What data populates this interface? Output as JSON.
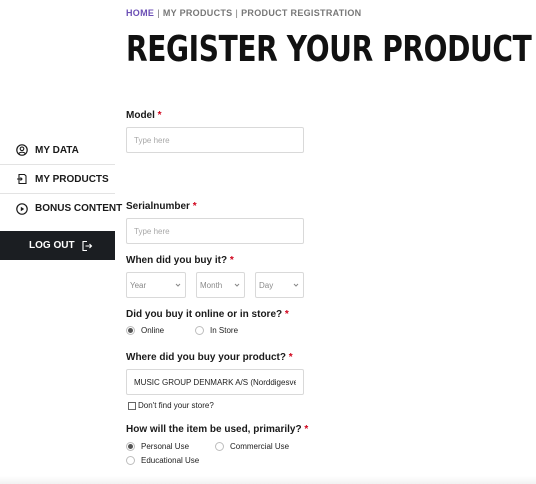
{
  "breadcrumb": {
    "home": "HOME",
    "my_products": "MY PRODUCTS",
    "current": "PRODUCT REGISTRATION",
    "separator": "|"
  },
  "page_title": "REGISTER YOUR PRODUCT",
  "sidebar": {
    "items": [
      {
        "label": "MY DATA",
        "icon": "user-circle-icon"
      },
      {
        "label": "MY PRODUCTS",
        "icon": "product-register-icon"
      },
      {
        "label": "BONUS CONTENT",
        "icon": "play-circle-icon"
      }
    ],
    "logout": {
      "label": "LOG OUT",
      "icon": "logout-icon"
    }
  },
  "form": {
    "required_marker": "*",
    "model": {
      "label": "Model",
      "placeholder": "Type here",
      "value": ""
    },
    "serial": {
      "label": "Serialnumber",
      "placeholder": "Type here",
      "value": ""
    },
    "purchase_date": {
      "label": "When did you buy it?",
      "year": "Year",
      "month": "Month",
      "day": "Day"
    },
    "channel": {
      "label": "Did you buy it online or in store?",
      "options": [
        "Online",
        "In Store"
      ],
      "selected": "Online"
    },
    "store": {
      "label": "Where did you buy your product?",
      "value": "MUSIC GROUP DENMARK A/S (Norddigesvej"
    },
    "no_store": {
      "label": "Don't find your store?",
      "checked": false
    },
    "usage": {
      "label": "How will the item be used, primarily?",
      "options": [
        "Personal Use",
        "Commercial Use",
        "Educational Use"
      ],
      "selected": "Personal Use"
    }
  },
  "colors": {
    "accent": "#6b4fb5",
    "required": "#d0021b",
    "logout_bg": "#1b1e22"
  }
}
